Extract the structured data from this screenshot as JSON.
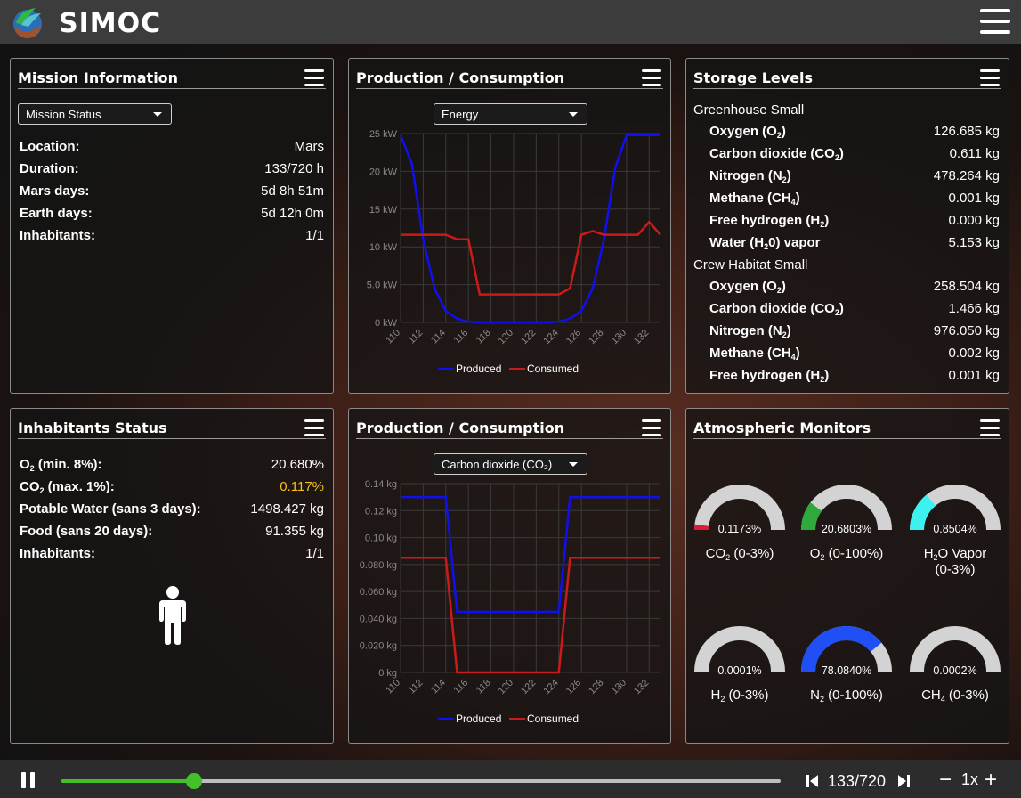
{
  "app": {
    "title": "SIMOC"
  },
  "mission_info": {
    "title": "Mission Information",
    "select_value": "Mission Status",
    "rows": [
      {
        "key": "Location:",
        "value": "Mars"
      },
      {
        "key": "Duration:",
        "value": "133/720 h"
      },
      {
        "key": "Mars days:",
        "value": "5d 8h 51m"
      },
      {
        "key": "Earth days:",
        "value": "5d 12h 0m"
      },
      {
        "key": "Inhabitants:",
        "value": "1/1"
      }
    ]
  },
  "energy_panel": {
    "title": "Production / Consumption",
    "select_value": "Energy"
  },
  "co2_panel": {
    "title": "Production / Consumption",
    "select_value": "Carbon dioxide (CO₂)"
  },
  "storage": {
    "title": "Storage Levels",
    "groups": [
      {
        "name": "Greenhouse Small",
        "items": [
          {
            "label": "Oxygen (O",
            "sub": "2",
            "tail": ")",
            "value": "126.685 kg"
          },
          {
            "label": "Carbon dioxide (CO",
            "sub": "2",
            "tail": ")",
            "value": "0.611 kg"
          },
          {
            "label": "Nitrogen (N",
            "sub": "2",
            "tail": ")",
            "value": "478.264 kg"
          },
          {
            "label": "Methane (CH",
            "sub": "4",
            "tail": ")",
            "value": "0.001 kg"
          },
          {
            "label": "Free hydrogen (H",
            "sub": "2",
            "tail": ")",
            "value": "0.000 kg"
          },
          {
            "label": "Water (H",
            "sub": "2",
            "tail": "0) vapor",
            "value": "5.153 kg"
          }
        ]
      },
      {
        "name": "Crew Habitat Small",
        "items": [
          {
            "label": "Oxygen (O",
            "sub": "2",
            "tail": ")",
            "value": "258.504 kg"
          },
          {
            "label": "Carbon dioxide (CO",
            "sub": "2",
            "tail": ")",
            "value": "1.466 kg"
          },
          {
            "label": "Nitrogen (N",
            "sub": "2",
            "tail": ")",
            "value": "976.050 kg"
          },
          {
            "label": "Methane (CH",
            "sub": "4",
            "tail": ")",
            "value": "0.002 kg"
          },
          {
            "label": "Free hydrogen (H",
            "sub": "2",
            "tail": ")",
            "value": "0.001 kg"
          }
        ]
      }
    ]
  },
  "inhabitants": {
    "title": "Inhabitants Status",
    "rows": [
      {
        "key": "O",
        "sub": "2",
        "tail": " (min. 8%):",
        "value": "20.680%",
        "warn": false
      },
      {
        "key": "CO",
        "sub": "2",
        "tail": " (max. 1%):",
        "value": "0.117%",
        "warn": true
      },
      {
        "key": "Potable Water (sans 3 days):",
        "sub": "",
        "tail": "",
        "value": "1498.427 kg",
        "warn": false
      },
      {
        "key": "Food (sans 20 days):",
        "sub": "",
        "tail": "",
        "value": "91.355 kg",
        "warn": false
      },
      {
        "key": "Inhabitants:",
        "sub": "",
        "tail": "",
        "value": "1/1",
        "warn": false
      }
    ]
  },
  "atmo": {
    "title": "Atmospheric Monitors",
    "gauges": [
      {
        "value_text": "0.1173%",
        "fraction": 0.039,
        "color": "#e0193c",
        "label": "CO",
        "sub": "2",
        "tail": " (0-3%)",
        "line2": ""
      },
      {
        "value_text": "20.6803%",
        "fraction": 0.207,
        "color": "#2fa83c",
        "label": "O",
        "sub": "2",
        "tail": " (0-100%)",
        "line2": ""
      },
      {
        "value_text": "0.8504%",
        "fraction": 0.283,
        "color": "#3df1f1",
        "label": "H",
        "sub": "2",
        "tail": "O Vapor",
        "line2": "(0-3%)"
      },
      {
        "value_text": "0.0001%",
        "fraction": 0.0,
        "color": "#e0193c",
        "label": "H",
        "sub": "2",
        "tail": " (0-3%)",
        "line2": ""
      },
      {
        "value_text": "78.0840%",
        "fraction": 0.781,
        "color": "#1f4ff5",
        "label": "N",
        "sub": "2",
        "tail": " (0-100%)",
        "line2": ""
      },
      {
        "value_text": "0.0002%",
        "fraction": 0.0,
        "color": "#e0193c",
        "label": "CH",
        "sub": "4",
        "tail": " (0-3%)",
        "line2": ""
      }
    ]
  },
  "chart_data": [
    {
      "type": "line",
      "title": "",
      "x": [
        110,
        111,
        112,
        113,
        114,
        115,
        116,
        117,
        118,
        119,
        120,
        121,
        122,
        123,
        124,
        125,
        126,
        127,
        128,
        129,
        130,
        131,
        132,
        133
      ],
      "x_ticks": [
        "110",
        "112",
        "114",
        "116",
        "118",
        "120",
        "122",
        "124",
        "126",
        "128",
        "130",
        "132"
      ],
      "y_ticks": [
        "0 kW",
        "5.0 kW",
        "10 kW",
        "15 kW",
        "20 kW",
        "25 kW"
      ],
      "ylim": [
        0,
        25
      ],
      "series": [
        {
          "name": "Produced",
          "color": "#1010ee",
          "values": [
            24.8,
            21,
            11,
            4.5,
            1.5,
            0.5,
            0.1,
            0,
            0,
            0,
            0,
            0,
            0,
            0,
            0.1,
            0.5,
            1.5,
            4.5,
            11,
            20.5,
            24.8,
            24.8,
            24.8,
            24.8
          ]
        },
        {
          "name": "Consumed",
          "color": "#cc1a1a",
          "values": [
            11.6,
            11.6,
            11.6,
            11.6,
            11.6,
            11.0,
            11.0,
            3.7,
            3.7,
            3.7,
            3.7,
            3.7,
            3.7,
            3.7,
            3.7,
            4.5,
            11.6,
            12.1,
            11.6,
            11.6,
            11.6,
            11.6,
            13.3,
            11.6
          ]
        }
      ],
      "legend": "bottom",
      "grid": true
    },
    {
      "type": "line",
      "title": "",
      "x": [
        110,
        111,
        112,
        113,
        114,
        115,
        116,
        117,
        118,
        119,
        120,
        121,
        122,
        123,
        124,
        125,
        126,
        127,
        128,
        129,
        130,
        131,
        132,
        133
      ],
      "x_ticks": [
        "110",
        "112",
        "114",
        "116",
        "118",
        "120",
        "122",
        "124",
        "126",
        "128",
        "130",
        "132"
      ],
      "y_ticks": [
        "0 kg",
        "0.020 kg",
        "0.040 kg",
        "0.060 kg",
        "0.080 kg",
        "0.10 kg",
        "0.12 kg",
        "0.14 kg"
      ],
      "ylim": [
        0,
        0.14
      ],
      "series": [
        {
          "name": "Produced",
          "color": "#1010ee",
          "values": [
            0.13,
            0.13,
            0.13,
            0.13,
            0.13,
            0.045,
            0.045,
            0.045,
            0.045,
            0.045,
            0.045,
            0.045,
            0.045,
            0.045,
            0.045,
            0.13,
            0.13,
            0.13,
            0.13,
            0.13,
            0.13,
            0.13,
            0.13,
            0.13
          ]
        },
        {
          "name": "Consumed",
          "color": "#cc1a1a",
          "values": [
            0.085,
            0.085,
            0.085,
            0.085,
            0.085,
            0.0,
            0.0,
            0.0,
            0.0,
            0.0,
            0.0,
            0.0,
            0.0,
            0.0,
            0.0,
            0.085,
            0.085,
            0.085,
            0.085,
            0.085,
            0.085,
            0.085,
            0.085,
            0.085
          ]
        }
      ],
      "legend": "bottom",
      "grid": true
    }
  ],
  "person_icon": "person-icon",
  "timeline": {
    "step_text": "133/720",
    "progress": 0.185,
    "speed": "1x",
    "minus": "−",
    "plus": "+"
  }
}
